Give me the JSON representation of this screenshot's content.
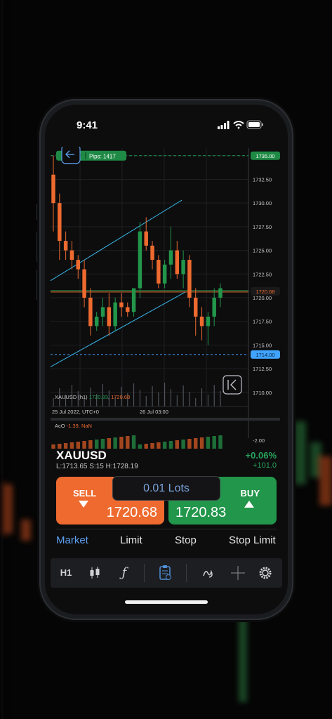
{
  "status": {
    "time": "9:41"
  },
  "chart": {
    "badge_text": "Pips: 1417",
    "badge_left": "T",
    "symbol_label": "XAUUSD (h1)",
    "bid": "1720.83",
    "ask": "1720.68",
    "x_labels": [
      "25 Jul 2022, UTC+0",
      "26 Jul 03:00"
    ],
    "y_labels": [
      "1735.00",
      "1732.50",
      "1730.00",
      "1727.50",
      "1725.00",
      "1722.50",
      "1720.00",
      "1717.50",
      "1715.00",
      "1712.50",
      "1710.00"
    ],
    "price_tags": {
      "top": "1735.00",
      "current": "1720.68",
      "low": "1714.00",
      "osc": "-2.00"
    },
    "osc_label": "AcO",
    "osc_value": "-1.39",
    "osc_nan": "NaN"
  },
  "chart_data": {
    "type": "candlestick",
    "ohlc": [
      [
        1733,
        1735,
        1727,
        1730
      ],
      [
        1730,
        1731,
        1724,
        1726
      ],
      [
        1726,
        1727,
        1724,
        1725
      ],
      [
        1725,
        1726,
        1723,
        1724
      ],
      [
        1724,
        1724.5,
        1722,
        1723
      ],
      [
        1723,
        1724,
        1719,
        1720
      ],
      [
        1720,
        1721,
        1716,
        1717
      ],
      [
        1717,
        1718.5,
        1716.5,
        1718
      ],
      [
        1718,
        1720,
        1717,
        1719
      ],
      [
        1719,
        1720.5,
        1716,
        1717
      ],
      [
        1717,
        1720,
        1716.5,
        1719.5
      ],
      [
        1719.5,
        1720.5,
        1718,
        1719
      ],
      [
        1719,
        1719.5,
        1718,
        1718.5
      ],
      [
        1718.5,
        1721,
        1718,
        1721
      ],
      [
        1721,
        1728,
        1720,
        1727
      ],
      [
        1727,
        1728.5,
        1725,
        1725.5
      ],
      [
        1725.5,
        1726,
        1723,
        1724
      ],
      [
        1724,
        1724.5,
        1721,
        1721.5
      ],
      [
        1721.5,
        1724,
        1721,
        1723.5
      ],
      [
        1723.5,
        1727.5,
        1722,
        1725
      ],
      [
        1725,
        1726,
        1722,
        1722.5
      ],
      [
        1722.5,
        1725,
        1721,
        1724
      ],
      [
        1724,
        1724.5,
        1719,
        1720
      ],
      [
        1720,
        1721,
        1716,
        1718
      ],
      [
        1718,
        1719,
        1715.5,
        1717
      ],
      [
        1717,
        1718.5,
        1715,
        1718
      ],
      [
        1718,
        1721,
        1717,
        1720
      ],
      [
        1720,
        1721.5,
        1719,
        1721
      ]
    ],
    "lines": {
      "upper_channel": "rising",
      "lower_channel": "rising"
    },
    "levels": [
      1735.0,
      1720.68,
      1714.0
    ]
  },
  "ticker": {
    "symbol": "XAUUSD",
    "stats": "L:1713.65  S:15  H:1728.19",
    "change_pct": "+0.06%",
    "change_pts": "+101.0"
  },
  "trade": {
    "sell_label": "SELL",
    "sell_price": "1720.68",
    "lots": "0.01 Lots",
    "buy_label": "BUY",
    "buy_price": "1720.83"
  },
  "order_tabs": [
    "Market",
    "Limit",
    "Stop",
    "Stop Limit"
  ],
  "toolbar": {
    "timeframe": "H1"
  },
  "colors": {
    "up": "#22964a",
    "down": "#ee6a2f",
    "accent": "#3fa3ff",
    "channel": "#37b6e6"
  }
}
